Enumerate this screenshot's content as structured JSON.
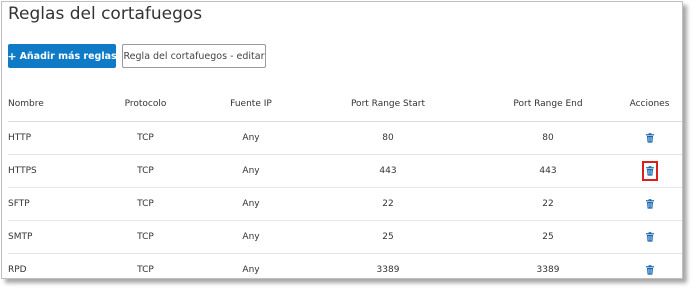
{
  "page": {
    "title": "Reglas del cortafuegos"
  },
  "toolbar": {
    "add_label": "Añadir más reglas",
    "add_icon": "+",
    "edit_label": "Regla del cortafuegos - editar"
  },
  "colors": {
    "primary": "#0f7ac6",
    "trash_icon": "#1565b0",
    "highlight": "#d9201f"
  },
  "table": {
    "headers": {
      "name": "Nombre",
      "protocol": "Protocolo",
      "source_ip": "Fuente IP",
      "port_start": "Port Range Start",
      "port_end": "Port Range End",
      "actions": "Acciones"
    },
    "rows": [
      {
        "name": "HTTP",
        "protocol": "TCP",
        "source_ip": "Any",
        "port_start": "80",
        "port_end": "80",
        "action_icon": "trash-icon",
        "highlighted": false
      },
      {
        "name": "HTTPS",
        "protocol": "TCP",
        "source_ip": "Any",
        "port_start": "443",
        "port_end": "443",
        "action_icon": "trash-icon",
        "highlighted": true
      },
      {
        "name": "SFTP",
        "protocol": "TCP",
        "source_ip": "Any",
        "port_start": "22",
        "port_end": "22",
        "action_icon": "trash-icon",
        "highlighted": false
      },
      {
        "name": "SMTP",
        "protocol": "TCP",
        "source_ip": "Any",
        "port_start": "25",
        "port_end": "25",
        "action_icon": "trash-icon",
        "highlighted": false
      },
      {
        "name": "RPD",
        "protocol": "TCP",
        "source_ip": "Any",
        "port_start": "3389",
        "port_end": "3389",
        "action_icon": "trash-icon",
        "highlighted": false
      }
    ]
  }
}
